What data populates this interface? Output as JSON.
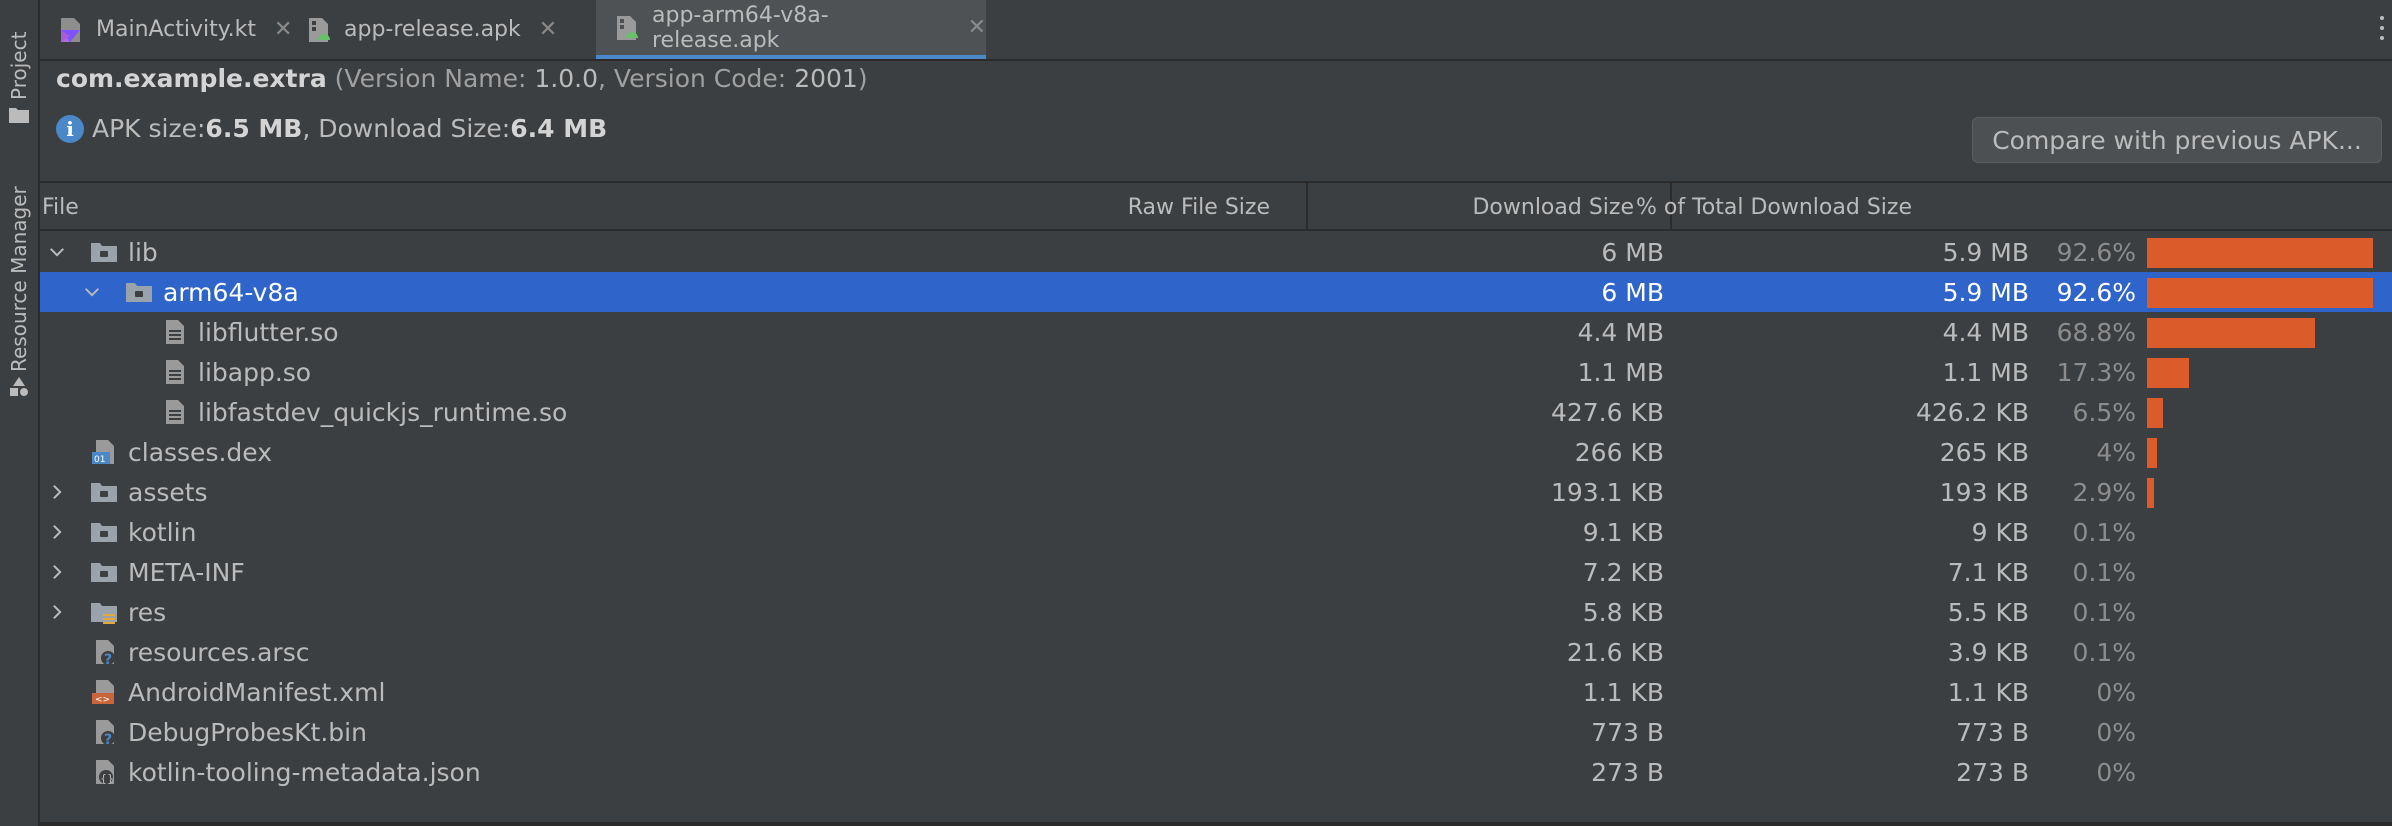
{
  "sidebar": {
    "project_label": "Project",
    "resource_manager_label": "Resource Manager"
  },
  "tabs": [
    {
      "label": "MainActivity.kt",
      "icon": "kotlin-file-icon",
      "active": false
    },
    {
      "label": "app-release.apk",
      "icon": "apk-file-icon",
      "active": false
    },
    {
      "label": "app-arm64-v8a-release.apk",
      "icon": "apk-file-icon",
      "active": true
    }
  ],
  "header": {
    "package_name": "com.example.extra",
    "version_prefix": " (Version Name: ",
    "version_name": "1.0.0",
    "version_mid": ", Version Code: ",
    "version_code": "2001",
    "version_suffix": ")",
    "apk_size_label": "APK size: ",
    "apk_size": "6.5 MB",
    "download_size_label": ", Download Size: ",
    "download_size": "6.4 MB",
    "compare_button": "Compare with previous APK..."
  },
  "columns": {
    "file": "File",
    "raw": "Raw File Size",
    "download": "Download Size",
    "percent": "% of Total Download Size"
  },
  "rows": [
    {
      "name": "lib",
      "depth": 0,
      "type": "folder",
      "expander": "expanded",
      "raw": "6 MB",
      "download": "5.9 MB",
      "percent": "92.6%",
      "share": 92.6,
      "selected": false
    },
    {
      "name": "arm64-v8a",
      "depth": 1,
      "type": "folder",
      "expander": "expanded",
      "raw": "6 MB",
      "download": "5.9 MB",
      "percent": "92.6%",
      "share": 92.6,
      "selected": true
    },
    {
      "name": "libflutter.so",
      "depth": 2,
      "type": "file",
      "expander": "none",
      "raw": "4.4 MB",
      "download": "4.4 MB",
      "percent": "68.8%",
      "share": 68.8,
      "selected": false
    },
    {
      "name": "libapp.so",
      "depth": 2,
      "type": "file",
      "expander": "none",
      "raw": "1.1 MB",
      "download": "1.1 MB",
      "percent": "17.3%",
      "share": 17.3,
      "selected": false
    },
    {
      "name": "libfastdev_quickjs_runtime.so",
      "depth": 2,
      "type": "file",
      "expander": "none",
      "raw": "427.6 KB",
      "download": "426.2 KB",
      "percent": "6.5%",
      "share": 6.5,
      "selected": false
    },
    {
      "name": "classes.dex",
      "depth": 0,
      "type": "dex",
      "expander": "none",
      "raw": "266 KB",
      "download": "265 KB",
      "percent": "4%",
      "share": 4,
      "selected": false
    },
    {
      "name": "assets",
      "depth": 0,
      "type": "folder",
      "expander": "collapsed",
      "raw": "193.1 KB",
      "download": "193 KB",
      "percent": "2.9%",
      "share": 2.9,
      "selected": false
    },
    {
      "name": "kotlin",
      "depth": 0,
      "type": "folder",
      "expander": "collapsed",
      "raw": "9.1 KB",
      "download": "9 KB",
      "percent": "0.1%",
      "share": 0.1,
      "selected": false
    },
    {
      "name": "META-INF",
      "depth": 0,
      "type": "folder",
      "expander": "collapsed",
      "raw": "7.2 KB",
      "download": "7.1 KB",
      "percent": "0.1%",
      "share": 0.1,
      "selected": false
    },
    {
      "name": "res",
      "depth": 0,
      "type": "res-folder",
      "expander": "collapsed",
      "raw": "5.8 KB",
      "download": "5.5 KB",
      "percent": "0.1%",
      "share": 0.1,
      "selected": false
    },
    {
      "name": "resources.arsc",
      "depth": 0,
      "type": "unknown",
      "expander": "none",
      "raw": "21.6 KB",
      "download": "3.9 KB",
      "percent": "0.1%",
      "share": 0.1,
      "selected": false
    },
    {
      "name": "AndroidManifest.xml",
      "depth": 0,
      "type": "xml",
      "expander": "none",
      "raw": "1.1 KB",
      "download": "1.1 KB",
      "percent": "0%",
      "share": 0,
      "selected": false
    },
    {
      "name": "DebugProbesKt.bin",
      "depth": 0,
      "type": "unknown",
      "expander": "none",
      "raw": "773 B",
      "download": "773 B",
      "percent": "0%",
      "share": 0,
      "selected": false
    },
    {
      "name": "kotlin-tooling-metadata.json",
      "depth": 0,
      "type": "json",
      "expander": "none",
      "raw": "273 B",
      "download": "273 B",
      "percent": "0%",
      "share": 0,
      "selected": false
    }
  ],
  "colors": {
    "bar": "#db5b2b",
    "selection": "#2f65ca",
    "tab_underline": "#4a88c7",
    "background": "#3c3f41"
  }
}
